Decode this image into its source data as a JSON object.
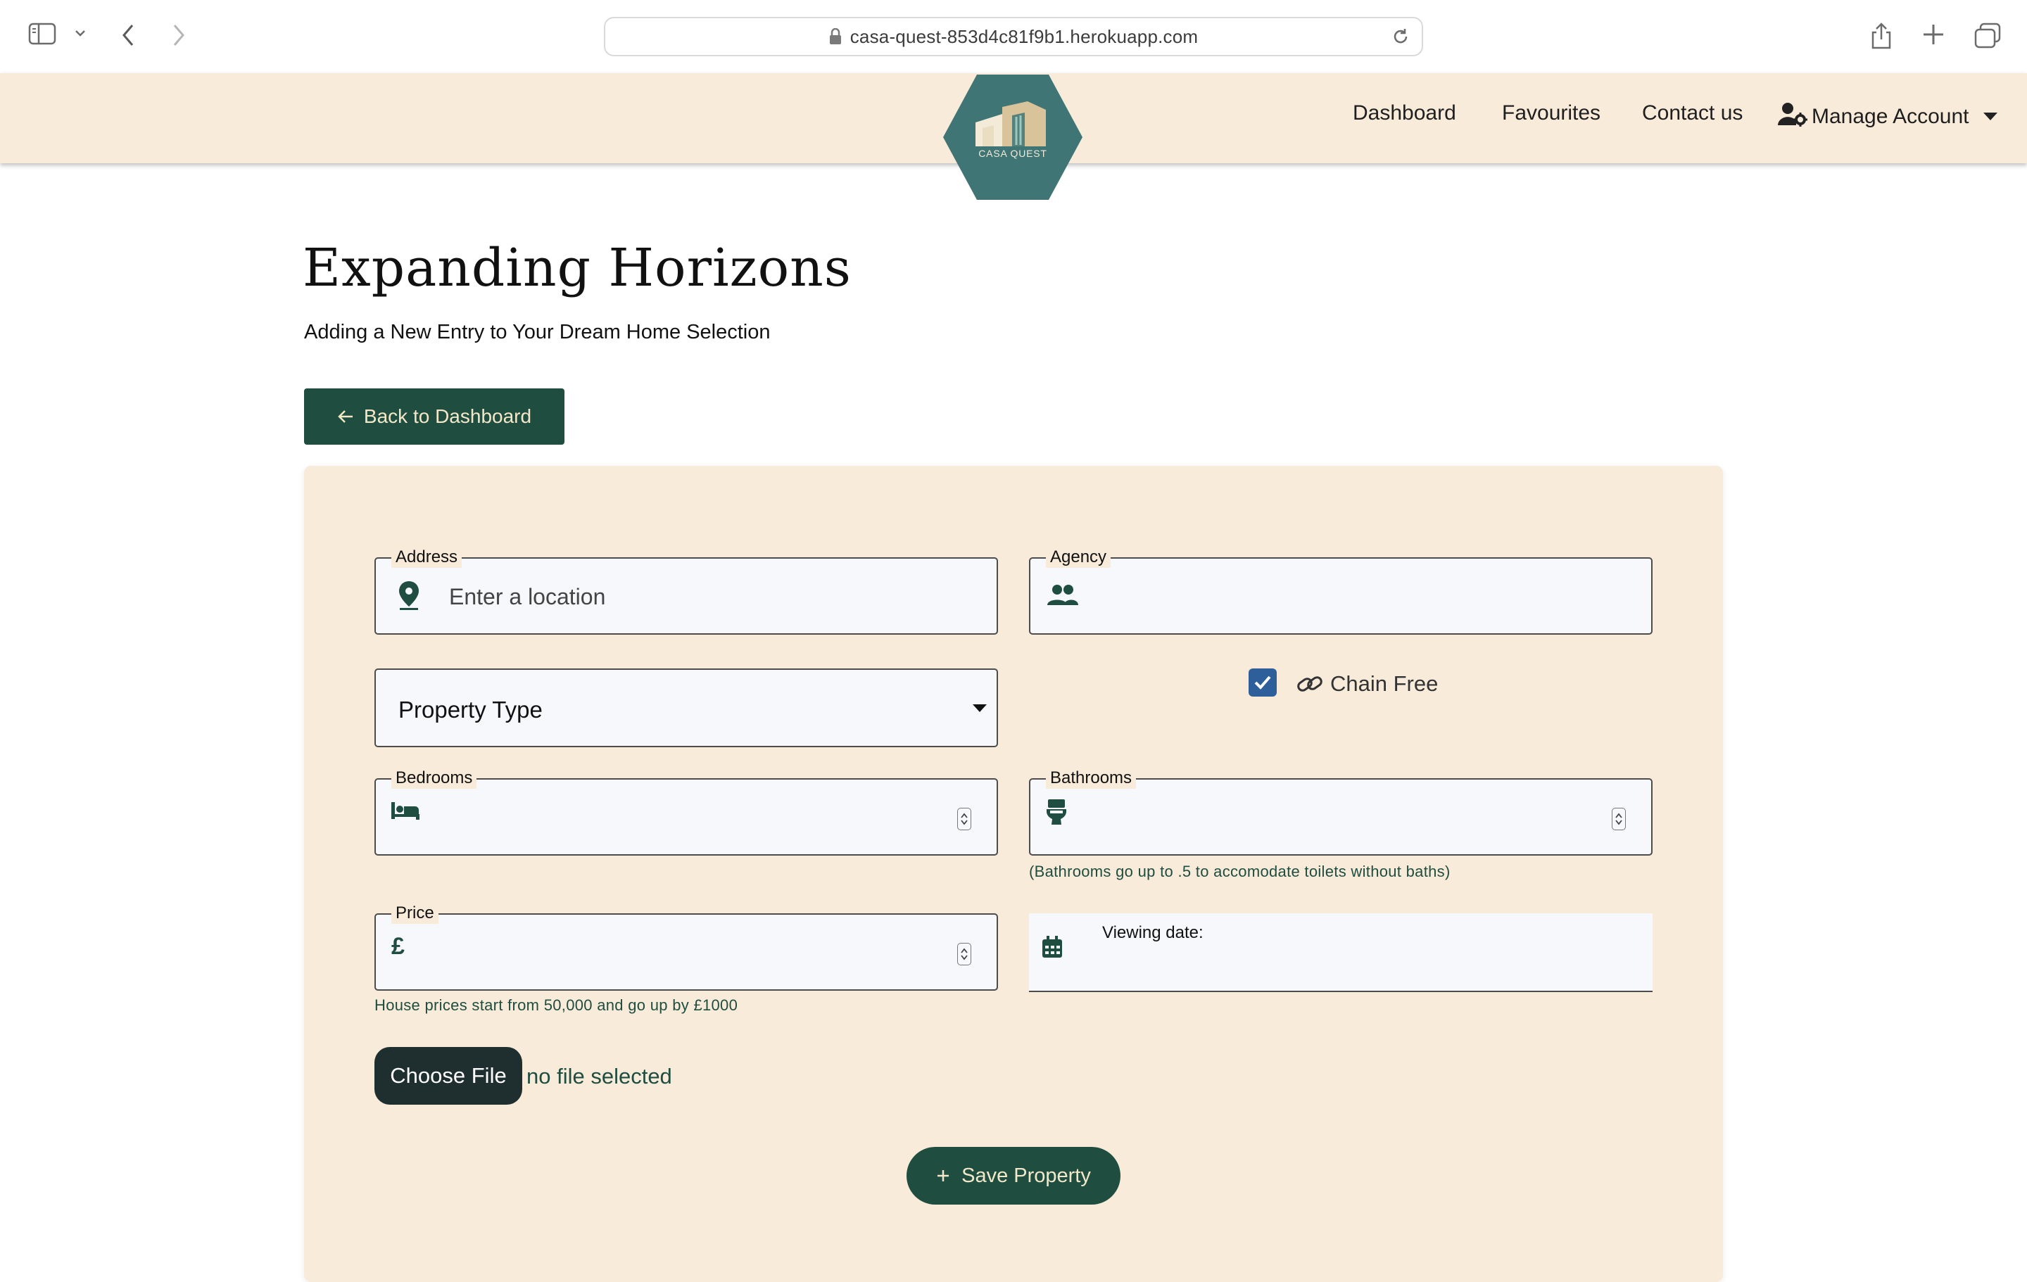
{
  "browser": {
    "url": "casa-quest-853d4c81f9b1.herokuapp.com",
    "icons": [
      "sidebar-icon",
      "chevron-down-icon",
      "back-arrow-icon",
      "forward-arrow-icon",
      "lock-icon",
      "reload-icon",
      "share-icon",
      "new-tab-icon",
      "tabs-overview-icon"
    ]
  },
  "navbar": {
    "logo_text": "CASA QUEST",
    "links": [
      "Dashboard",
      "Favourites",
      "Contact us"
    ],
    "account_label": "Manage Account"
  },
  "header": {
    "title": "Expanding Horizons",
    "subtitle": "Adding a New Entry to Your Dream Home Selection",
    "back_button": "Back to Dashboard"
  },
  "form": {
    "address": {
      "label": "Address",
      "placeholder": "Enter a location",
      "icon": "map-pin-icon"
    },
    "agency": {
      "label": "Agency",
      "value": "",
      "icon": "people-icon"
    },
    "property_type": {
      "selected": "Property Type"
    },
    "chain_free": {
      "label": "Chain Free",
      "checked": true,
      "icon": "link-icon"
    },
    "bedrooms": {
      "label": "Bedrooms",
      "value": "",
      "icon": "bed-icon"
    },
    "bathrooms": {
      "label": "Bathrooms",
      "value": "",
      "icon": "toilet-icon",
      "help": "(Bathrooms go up to .5 to accomodate toilets without baths)"
    },
    "price": {
      "label": "Price",
      "value": "",
      "currency_symbol": "£",
      "help": "House prices start from 50,000 and go up by £1000"
    },
    "viewing_date": {
      "label": "Viewing date:",
      "value": "",
      "icon": "calendar-icon"
    },
    "file": {
      "button": "Choose File",
      "status": "no file selected"
    },
    "save_button": "Save Property"
  },
  "colors": {
    "nav_bg": "#f8ebd9",
    "brand_green": "#1f4d40",
    "logo_teal": "#3f7574",
    "checkbox_blue": "#2f5f9b",
    "button_text": "#f3e7c9"
  }
}
